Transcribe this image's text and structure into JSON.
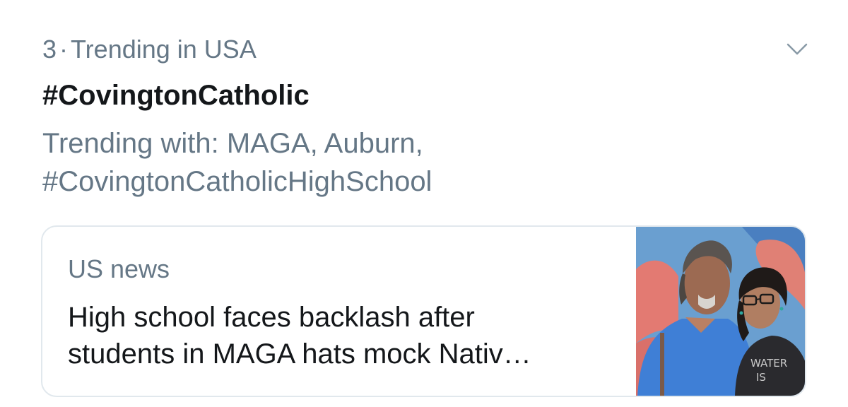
{
  "trend": {
    "rank": "3",
    "separator": "·",
    "location": "Trending in USA",
    "hashtag": "#CovingtonCatholic",
    "trending_with_line1": "Trending with: MAGA, Auburn,",
    "trending_with_line2": "#CovingtonCatholicHighSchool",
    "menu_icon": "chevron-down-icon"
  },
  "card": {
    "source": "US news",
    "headline_line1": "High school faces backlash after",
    "headline_line2": "students in MAGA hats mock Nativ…",
    "image_text_line1": "WATER",
    "image_text_line2": "IS"
  },
  "colors": {
    "primary_text": "#14171a",
    "secondary_text": "#657786",
    "border": "#e1e8ed"
  }
}
